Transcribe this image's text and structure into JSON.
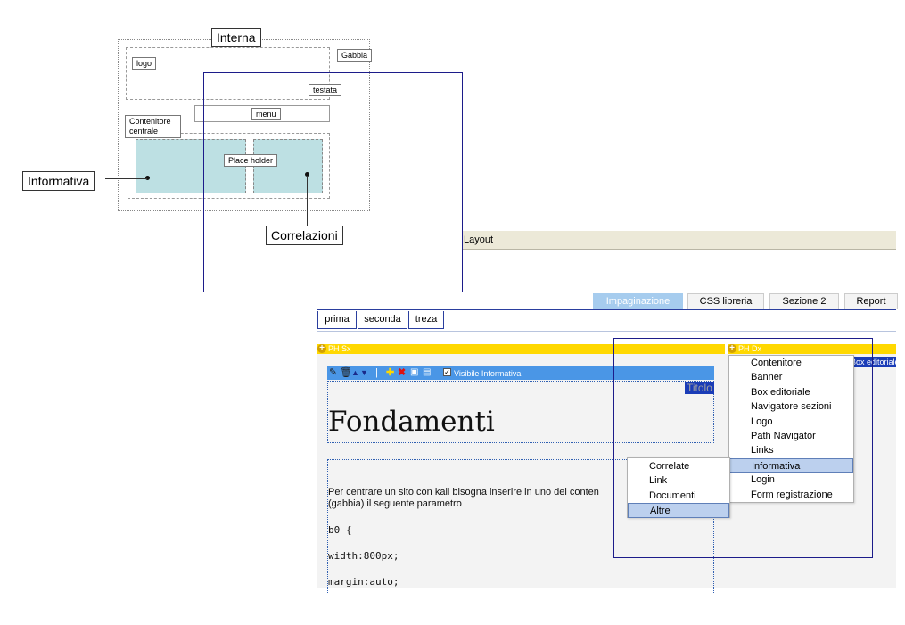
{
  "diagram": {
    "title": "Interna",
    "gabbia": "Gabbia",
    "logo": "logo",
    "testata": "testata",
    "menu": "menu",
    "contenitore": "Contenitore centrale",
    "placeholder": "Place holder",
    "callout_left": "Informativa",
    "callout_bottom": "Correlazioni"
  },
  "app": {
    "menubar_label": "Layout",
    "main_tabs": [
      {
        "label": "Impaginazione",
        "active": true
      },
      {
        "label": "CSS libreria",
        "active": false
      },
      {
        "label": "Sezione 2",
        "active": false
      },
      {
        "label": "Report",
        "active": false
      }
    ],
    "sub_tabs": [
      "prima",
      "seconda",
      "treza"
    ],
    "ph_left": "PH Sx",
    "ph_right": "PH Dx",
    "toolbar_checkbox_label": "Visibile Informativa",
    "titolo": "Titolo",
    "heading": "Fondamenti",
    "body_line1": "Per centrare un sito con kali bisogna inserire in uno dei conten",
    "body_line2": "(gabbia) il seguente parametro",
    "code1": "b0 {",
    "code2": "width:800px;",
    "code3": "margin:auto;",
    "right_tag": "Box editoriale",
    "context_menu": [
      "Contenitore",
      "Banner",
      "Box editoriale",
      "Navigatore sezioni",
      "Logo",
      "Path Navigator",
      "Links",
      "Informativa",
      "Login",
      "Form registrazione"
    ],
    "context_menu_selected": 7,
    "submenu": [
      "Correlate",
      "Link",
      "Documenti",
      "Altre"
    ],
    "submenu_selected": 3
  },
  "colors": {
    "active_tab": "#a6ccee",
    "toolbar": "#4a96e6",
    "ph_bar": "#ffd800",
    "placeholder_fill": "#bde0e3",
    "menu_highlight": "#bcd0ee"
  }
}
